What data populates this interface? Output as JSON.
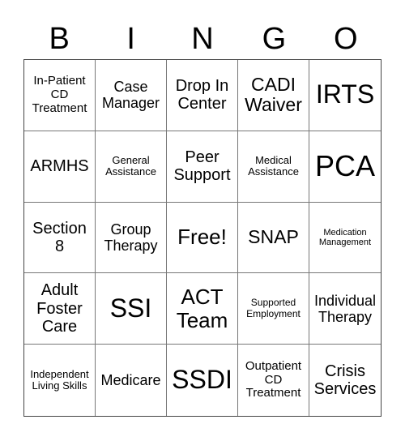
{
  "header": {
    "letters": [
      "B",
      "I",
      "N",
      "G",
      "O"
    ]
  },
  "cells": [
    "In-Patient CD Treatment",
    "Case Manager",
    "Drop In Center",
    "CADI Waiver",
    "IRTS",
    "ARMHS",
    "General Assistance",
    "Peer Support",
    "Medical Assistance",
    "PCA",
    "Section 8",
    "Group Therapy",
    "Free!",
    "SNAP",
    "Medication Management",
    "Adult Foster Care",
    "SSI",
    "ACT Team",
    "Supported Employment",
    "Individual Therapy",
    "Independent Living Skills",
    "Medicare",
    "SSDI",
    "Outpatient CD Treatment",
    "Crisis Services"
  ]
}
